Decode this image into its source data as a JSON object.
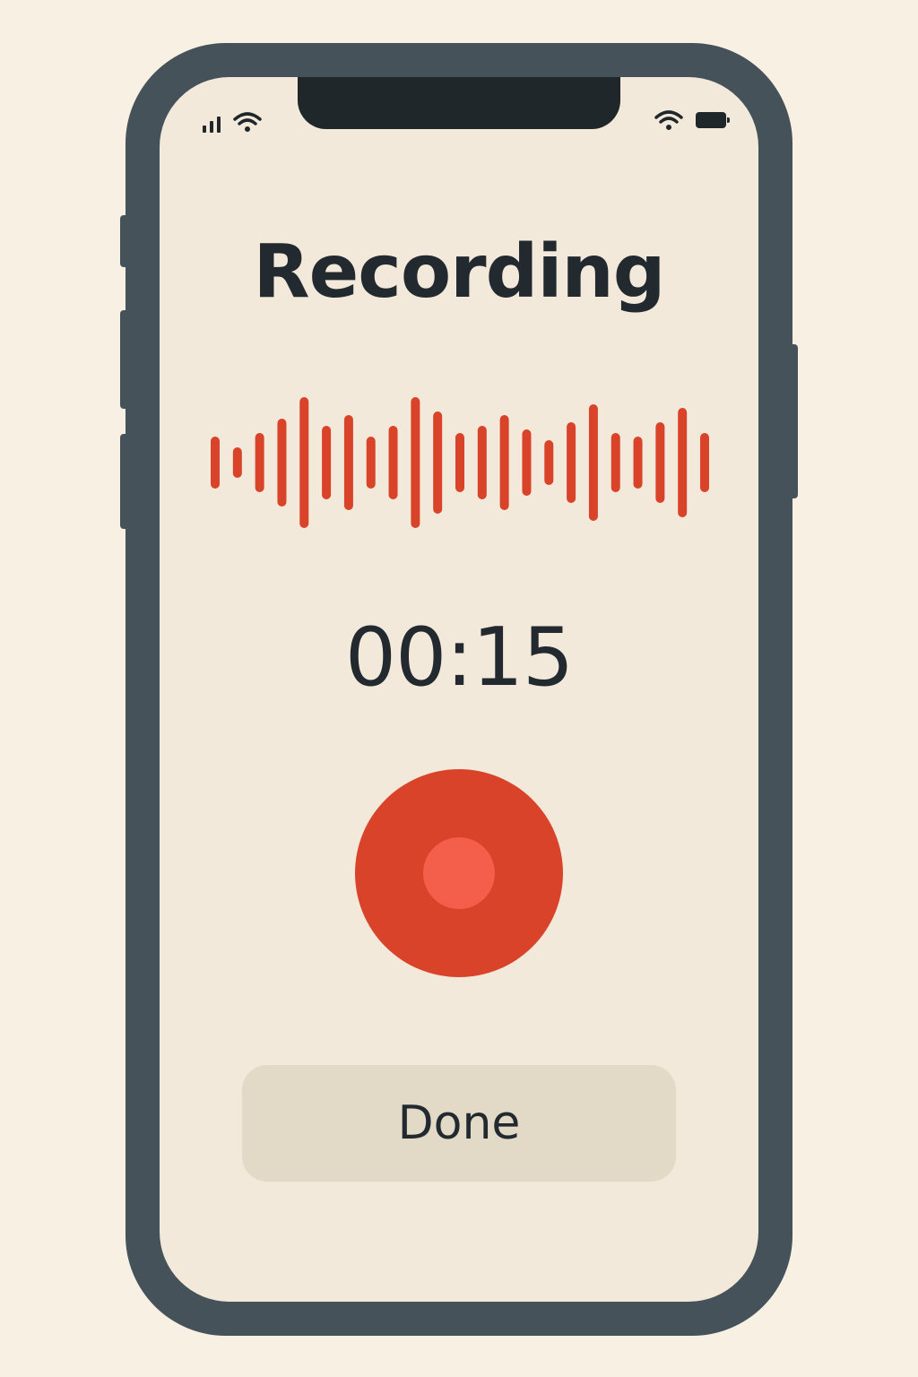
{
  "app": {
    "title": "Recording",
    "timer": "00:15",
    "done_label": "Done"
  },
  "status_bar": {
    "icons": [
      "cellular-signal-icon",
      "wifi-icon",
      "wifi-icon",
      "battery-icon"
    ]
  },
  "waveform": {
    "color": "#d8432a",
    "levels": [
      0.3,
      0.15,
      0.35,
      0.55,
      0.85,
      0.45,
      0.6,
      0.3,
      0.45,
      0.85,
      0.65,
      0.35,
      0.45,
      0.6,
      0.4,
      0.25,
      0.5,
      0.75,
      0.35,
      0.3,
      0.5,
      0.7,
      0.35
    ]
  },
  "colors": {
    "accent": "#d8432a",
    "accent_light": "#f35f4a",
    "screen_bg": "#f3e9da",
    "frame": "#46525a",
    "text": "#222a30",
    "button_bg": "#e2d9c7"
  }
}
